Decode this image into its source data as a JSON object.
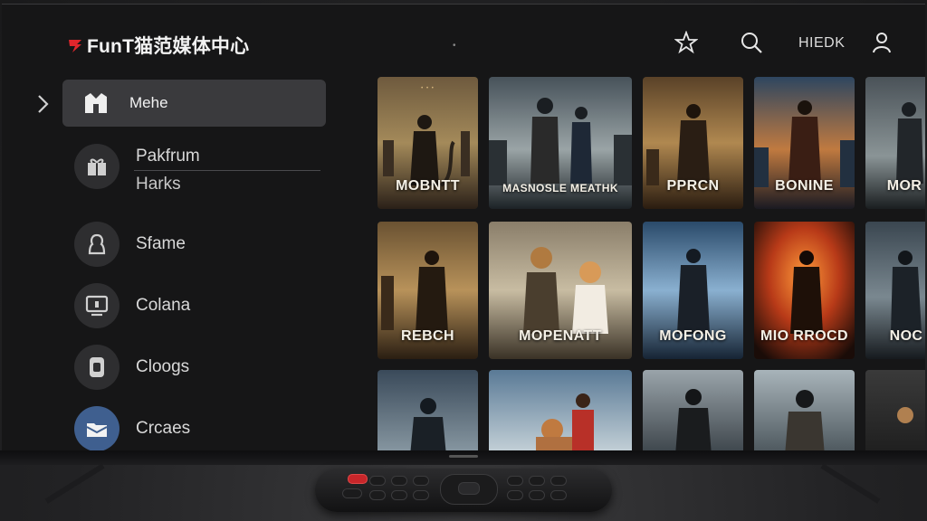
{
  "app": {
    "title": "FunT猫范媒体中心"
  },
  "header": {
    "user_label": "HIEDK",
    "icons": [
      "star-icon",
      "search-icon",
      "user-icon"
    ]
  },
  "sidebar": {
    "active": {
      "label": "Mehe",
      "icon": "home-icon"
    },
    "items": [
      {
        "label": "Pakfrum",
        "sub": "Harks",
        "icon": "gift-icon"
      },
      {
        "label": "Sfame",
        "icon": "person-icon"
      },
      {
        "label": "Colana",
        "icon": "monitor-icon"
      },
      {
        "label": "Cloogs",
        "icon": "tag-icon"
      },
      {
        "label": "Crcaes",
        "icon": "folder-icon"
      }
    ]
  },
  "posters": {
    "row1": [
      "MOBNTT",
      "MASNOSLE MEATHK",
      "PPRCN",
      "BONINE",
      "MOR"
    ],
    "row2": [
      "REBCH",
      "MOPENATT",
      "MOFONG",
      "MIO RROCD",
      "NOC"
    ]
  },
  "colors": {
    "accent": "#3f5f8f",
    "logo_red": "#e0262c",
    "active_bg": "#3a3a3d"
  }
}
